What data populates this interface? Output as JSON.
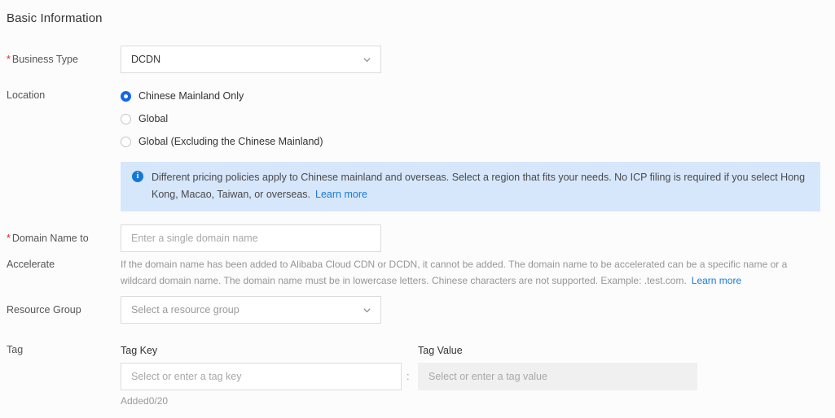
{
  "page": {
    "title": "Basic Information",
    "background_color": "#fcfcfc",
    "accent_color": "#1366ec",
    "link_color": "#1b7ad6",
    "required_star_color": "#d93026"
  },
  "business_type": {
    "label": "Business Type",
    "required_marker": "*",
    "value": "DCDN",
    "chevron_icon": "chevron-down-icon"
  },
  "location": {
    "label": "Location",
    "options": [
      {
        "label": "Chinese Mainland Only",
        "selected": true
      },
      {
        "label": "Global",
        "selected": false
      },
      {
        "label": "Global (Excluding the Chinese Mainland)",
        "selected": false
      }
    ]
  },
  "info_banner": {
    "icon": "info-circle-icon",
    "text": "Different pricing policies apply to Chinese mainland and overseas. Select a region that fits your needs. No ICP filing is required if you select Hong Kong, Macao, Taiwan, or overseas.",
    "link_label": "Learn more",
    "background_color": "#d6e7fb"
  },
  "domain_name": {
    "label_line1": "Domain Name to",
    "label_line2": "Accelerate",
    "required_marker": "*",
    "placeholder": "Enter a single domain name",
    "value": "",
    "help_text": "If the domain name has been added to Alibaba Cloud CDN or DCDN, it cannot be added. The domain name to be accelerated can be a specific name or a wildcard domain name. The domain name must be in lowercase letters. Chinese characters are not supported. Example: .test.com.",
    "help_link_label": "Learn more"
  },
  "resource_group": {
    "label": "Resource Group",
    "placeholder": "Select a resource group",
    "value": "",
    "chevron_icon": "chevron-down-icon"
  },
  "tag": {
    "label": "Tag",
    "key_column_label": "Tag Key",
    "value_column_label": "Tag Value",
    "key_placeholder": "Select or enter a tag key",
    "value_placeholder": "Select or enter a tag value",
    "key_value": "",
    "value_value": "",
    "separator": ":",
    "added_count_text": "Added0/20",
    "value_field_disabled": true
  }
}
